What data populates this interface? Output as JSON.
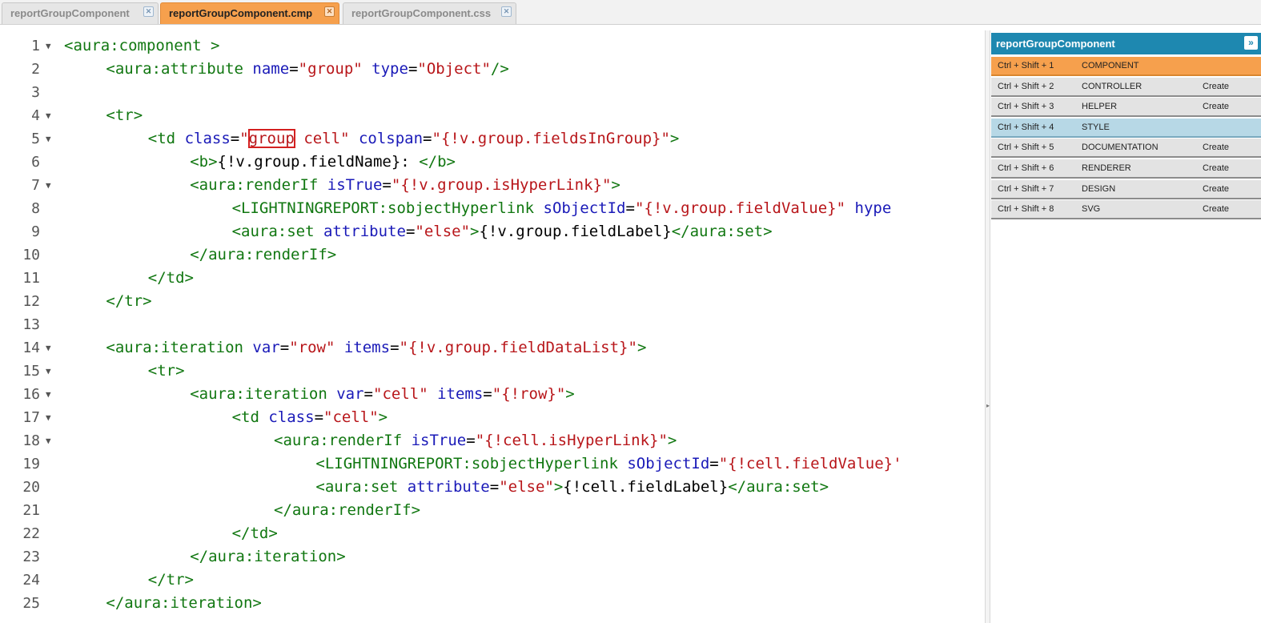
{
  "tabs": [
    {
      "label": "reportGroupComponent",
      "active": false
    },
    {
      "label": "reportGroupComponent.cmp",
      "active": true
    },
    {
      "label": "reportGroupComponent.css",
      "active": false
    }
  ],
  "panel": {
    "title": "reportGroupComponent",
    "collapse_icon": "»",
    "rows": [
      {
        "shortcut": "Ctrl + Shift + 1",
        "name": "COMPONENT",
        "action": "",
        "state": "active"
      },
      {
        "shortcut": "Ctrl + Shift + 2",
        "name": "CONTROLLER",
        "action": "Create",
        "state": ""
      },
      {
        "shortcut": "Ctrl + Shift + 3",
        "name": "HELPER",
        "action": "Create",
        "state": ""
      },
      {
        "shortcut": "Ctrl + Shift + 4",
        "name": "STYLE",
        "action": "",
        "state": "style"
      },
      {
        "shortcut": "Ctrl + Shift + 5",
        "name": "DOCUMENTATION",
        "action": "Create",
        "state": ""
      },
      {
        "shortcut": "Ctrl + Shift + 6",
        "name": "RENDERER",
        "action": "Create",
        "state": ""
      },
      {
        "shortcut": "Ctrl + Shift + 7",
        "name": "DESIGN",
        "action": "Create",
        "state": ""
      },
      {
        "shortcut": "Ctrl + Shift + 8",
        "name": "SVG",
        "action": "Create",
        "state": ""
      }
    ]
  },
  "colors": {
    "accent_orange": "#f6a04d",
    "panel_blue": "#1e88b0",
    "tag_green": "#117711",
    "attr_blue": "#1a1ab8",
    "string_red": "#b8161a"
  },
  "editor": {
    "lines": [
      {
        "n": "1",
        "fold": true,
        "indent": 0,
        "parts": [
          [
            "t",
            "<aura:component >"
          ]
        ]
      },
      {
        "n": "2",
        "fold": false,
        "indent": 4,
        "parts": [
          [
            "t",
            "<aura:attribute "
          ],
          [
            "a",
            "name"
          ],
          [
            "x",
            "="
          ],
          [
            "s",
            "\"group\""
          ],
          [
            "x",
            " "
          ],
          [
            "a",
            "type"
          ],
          [
            "x",
            "="
          ],
          [
            "s",
            "\"Object\""
          ],
          [
            "t",
            "/>"
          ]
        ]
      },
      {
        "n": "3",
        "fold": false,
        "indent": 0,
        "parts": []
      },
      {
        "n": "4",
        "fold": true,
        "indent": 4,
        "parts": [
          [
            "t",
            "<tr>"
          ]
        ]
      },
      {
        "n": "5",
        "fold": true,
        "indent": 8,
        "parts": [
          [
            "t",
            "<td "
          ],
          [
            "a",
            "class"
          ],
          [
            "x",
            "="
          ],
          [
            "s",
            "\""
          ],
          [
            "h",
            "group"
          ],
          [
            "s",
            " cell\""
          ],
          [
            "x",
            " "
          ],
          [
            "a",
            "colspan"
          ],
          [
            "x",
            "="
          ],
          [
            "s",
            "\"{!v.group.fieldsInGroup}\""
          ],
          [
            "t",
            ">"
          ]
        ]
      },
      {
        "n": "6",
        "fold": false,
        "indent": 12,
        "parts": [
          [
            "t",
            "<b>"
          ],
          [
            "x",
            "{!v.group.fieldName}: "
          ],
          [
            "t",
            "</b>"
          ]
        ]
      },
      {
        "n": "7",
        "fold": true,
        "indent": 12,
        "parts": [
          [
            "t",
            "<aura:renderIf "
          ],
          [
            "a",
            "isTrue"
          ],
          [
            "x",
            "="
          ],
          [
            "s",
            "\"{!v.group.isHyperLink}\""
          ],
          [
            "t",
            ">"
          ]
        ]
      },
      {
        "n": "8",
        "fold": false,
        "indent": 16,
        "parts": [
          [
            "t",
            "<LIGHTNINGREPORT:sobjectHyperlink "
          ],
          [
            "a",
            "sObjectId"
          ],
          [
            "x",
            "="
          ],
          [
            "s",
            "\"{!v.group.fieldValue}\""
          ],
          [
            "x",
            " "
          ],
          [
            "a",
            "hype"
          ]
        ]
      },
      {
        "n": "9",
        "fold": false,
        "indent": 16,
        "parts": [
          [
            "t",
            "<aura:set "
          ],
          [
            "a",
            "attribute"
          ],
          [
            "x",
            "="
          ],
          [
            "s",
            "\"else\""
          ],
          [
            "t",
            ">"
          ],
          [
            "x",
            "{!v.group.fieldLabel}"
          ],
          [
            "t",
            "</aura:set>"
          ]
        ]
      },
      {
        "n": "10",
        "fold": false,
        "indent": 12,
        "parts": [
          [
            "t",
            "</aura:renderIf>"
          ]
        ]
      },
      {
        "n": "11",
        "fold": false,
        "indent": 8,
        "parts": [
          [
            "t",
            "</td>"
          ]
        ]
      },
      {
        "n": "12",
        "fold": false,
        "indent": 4,
        "parts": [
          [
            "t",
            "</tr>"
          ]
        ]
      },
      {
        "n": "13",
        "fold": false,
        "indent": 0,
        "parts": []
      },
      {
        "n": "14",
        "fold": true,
        "indent": 4,
        "parts": [
          [
            "t",
            "<aura:iteration "
          ],
          [
            "a",
            "var"
          ],
          [
            "x",
            "="
          ],
          [
            "s",
            "\"row\""
          ],
          [
            "x",
            " "
          ],
          [
            "a",
            "items"
          ],
          [
            "x",
            "="
          ],
          [
            "s",
            "\"{!v.group.fieldDataList}\""
          ],
          [
            "t",
            ">"
          ]
        ]
      },
      {
        "n": "15",
        "fold": true,
        "indent": 8,
        "parts": [
          [
            "t",
            "<tr>"
          ]
        ]
      },
      {
        "n": "16",
        "fold": true,
        "indent": 12,
        "parts": [
          [
            "t",
            "<aura:iteration "
          ],
          [
            "a",
            "var"
          ],
          [
            "x",
            "="
          ],
          [
            "s",
            "\"cell\""
          ],
          [
            "x",
            " "
          ],
          [
            "a",
            "items"
          ],
          [
            "x",
            "="
          ],
          [
            "s",
            "\"{!row}\""
          ],
          [
            "t",
            ">"
          ]
        ]
      },
      {
        "n": "17",
        "fold": true,
        "indent": 16,
        "parts": [
          [
            "t",
            "<td "
          ],
          [
            "a",
            "class"
          ],
          [
            "x",
            "="
          ],
          [
            "s",
            "\"cell\""
          ],
          [
            "t",
            ">"
          ]
        ]
      },
      {
        "n": "18",
        "fold": true,
        "indent": 20,
        "parts": [
          [
            "t",
            "<aura:renderIf "
          ],
          [
            "a",
            "isTrue"
          ],
          [
            "x",
            "="
          ],
          [
            "s",
            "\"{!cell.isHyperLink}\""
          ],
          [
            "t",
            ">"
          ]
        ]
      },
      {
        "n": "19",
        "fold": false,
        "indent": 24,
        "parts": [
          [
            "t",
            "<LIGHTNINGREPORT:sobjectHyperlink "
          ],
          [
            "a",
            "sObjectId"
          ],
          [
            "x",
            "="
          ],
          [
            "s",
            "\"{!cell.fieldValue}'"
          ]
        ]
      },
      {
        "n": "20",
        "fold": false,
        "indent": 24,
        "parts": [
          [
            "t",
            "<aura:set "
          ],
          [
            "a",
            "attribute"
          ],
          [
            "x",
            "="
          ],
          [
            "s",
            "\"else\""
          ],
          [
            "t",
            ">"
          ],
          [
            "x",
            "{!cell.fieldLabel}"
          ],
          [
            "t",
            "</aura:set>"
          ]
        ]
      },
      {
        "n": "21",
        "fold": false,
        "indent": 20,
        "parts": [
          [
            "t",
            "</aura:renderIf>"
          ]
        ]
      },
      {
        "n": "22",
        "fold": false,
        "indent": 16,
        "parts": [
          [
            "t",
            "</td>"
          ]
        ]
      },
      {
        "n": "23",
        "fold": false,
        "indent": 12,
        "parts": [
          [
            "t",
            "</aura:iteration>"
          ]
        ]
      },
      {
        "n": "24",
        "fold": false,
        "indent": 8,
        "parts": [
          [
            "t",
            "</tr>"
          ]
        ]
      },
      {
        "n": "25",
        "fold": false,
        "indent": 4,
        "parts": [
          [
            "t",
            "</aura:iteration>"
          ]
        ]
      }
    ]
  }
}
